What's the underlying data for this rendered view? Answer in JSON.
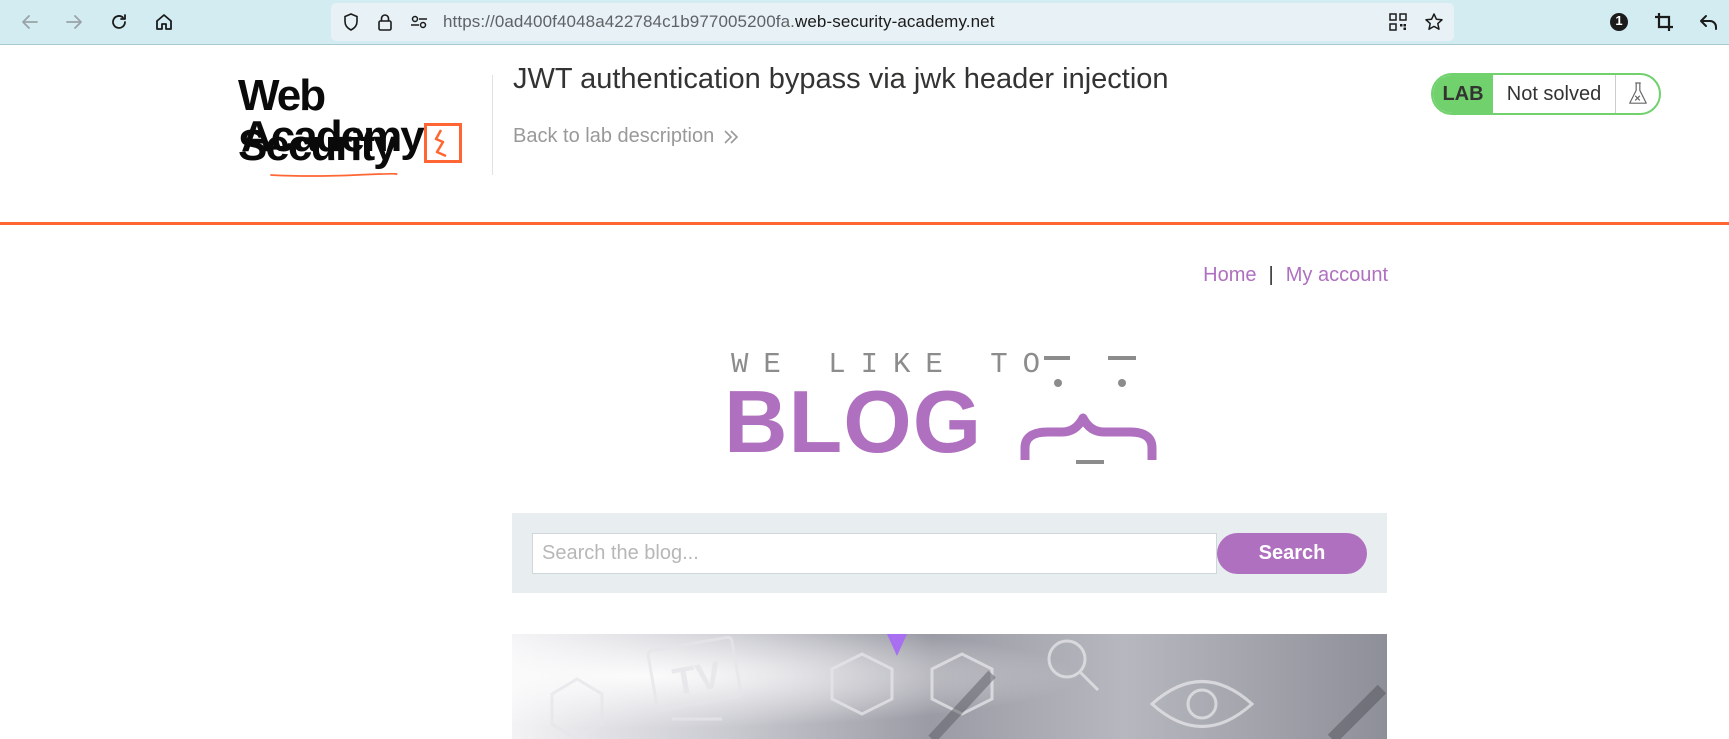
{
  "browser": {
    "url_prefix": "https://0ad400f4048a422784c1b977005200fa.",
    "url_domain": "web-security-academy.net",
    "notification_count": "1"
  },
  "lab_header": {
    "logo_line1": "Web Security",
    "logo_line2": "Academy",
    "title": "JWT authentication bypass via jwk header injection",
    "back_link": "Back to lab description",
    "status_badge": "LAB",
    "status_text": "Not solved"
  },
  "nav": {
    "home": "Home",
    "separator": "|",
    "my_account": "My account"
  },
  "banner": {
    "small_text": "WE LIKE TO",
    "big_text": "BLOG"
  },
  "search": {
    "placeholder": "Search the blog...",
    "button": "Search"
  },
  "colors": {
    "accent_purple": "#b070c0",
    "accent_orange": "#ff6633",
    "lab_green": "#70d16d",
    "toolbar_bg": "#d3ecf1"
  }
}
